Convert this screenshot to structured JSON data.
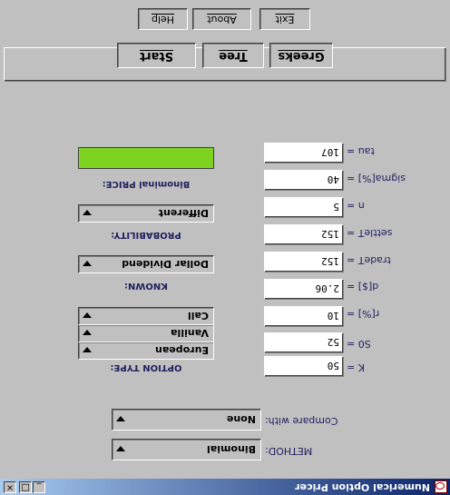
{
  "window": {
    "title": "Numerical Option Pricer",
    "controls": {
      "minimize": "_",
      "maximize": "□",
      "close": "×"
    }
  },
  "method": {
    "label": "METHOD:",
    "value": "Binomial"
  },
  "compare": {
    "label": "Compare with:",
    "value": "None"
  },
  "inputs": {
    "K": {
      "label": "K =",
      "value": "50"
    },
    "S0": {
      "label": "S0 =",
      "value": "52"
    },
    "r": {
      "label": "r[%] =",
      "value": "10"
    },
    "d": {
      "label": "d[$] =",
      "value": "2.06"
    },
    "tradeT": {
      "label": "tradeT =",
      "value": "152"
    },
    "settleT": {
      "label": "settleT =",
      "value": "152"
    },
    "n": {
      "label": "n =",
      "value": "5"
    },
    "sigma": {
      "label": "sigma[%] =",
      "value": "40"
    },
    "tau": {
      "label": "tau =",
      "value": "107"
    }
  },
  "option_type": {
    "label": "OPTION TYPE:",
    "style": "European",
    "kind": "Vanilla",
    "right": "Call"
  },
  "known": {
    "label": "KNOWN:",
    "value": "Dollar Dividend"
  },
  "probability": {
    "label": "PROBABILITY:",
    "value": "Different"
  },
  "price": {
    "label": "Binominal  PRICE:",
    "color": "#7ed321"
  },
  "buttons": {
    "start": "Start",
    "tree": "Tree",
    "greeks": "Greeks",
    "help": "Help",
    "about": "About",
    "exit": "Exit"
  }
}
